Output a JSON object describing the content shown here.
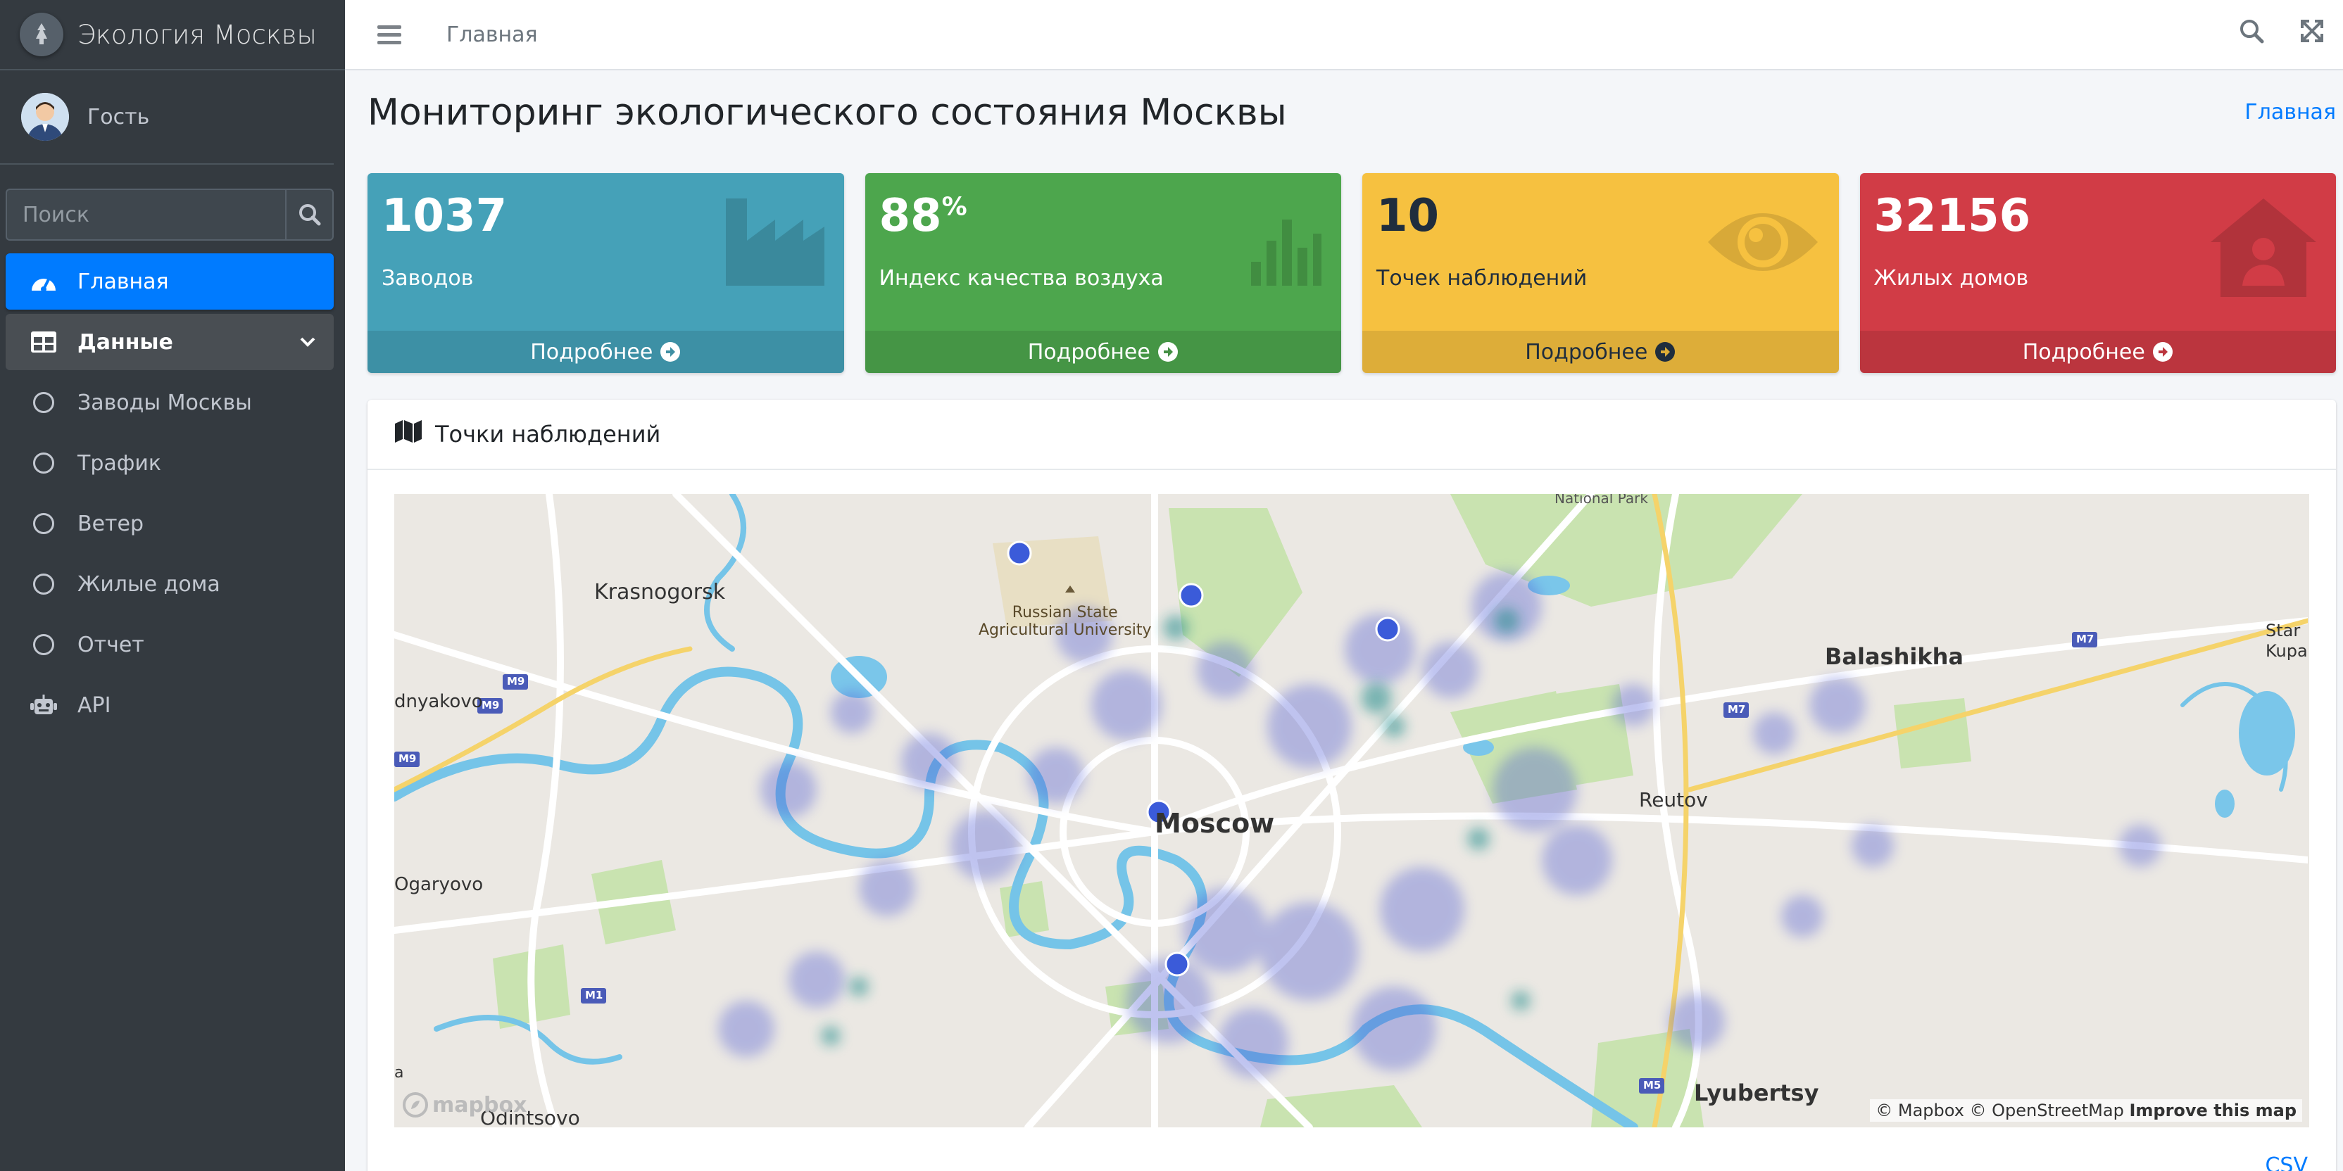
{
  "brand": {
    "title": "Экология Москвы"
  },
  "user": {
    "name": "Гость"
  },
  "search": {
    "placeholder": "Поиск"
  },
  "nav": {
    "items": [
      {
        "label": "Главная",
        "icon": "tachometer-icon"
      },
      {
        "label": "Данные",
        "icon": "table-icon"
      },
      {
        "label": "Заводы Москвы",
        "icon": "circle-icon"
      },
      {
        "label": "Трафик",
        "icon": "circle-icon"
      },
      {
        "label": "Ветер",
        "icon": "circle-icon"
      },
      {
        "label": "Жилые дома",
        "icon": "circle-icon"
      },
      {
        "label": "Отчет",
        "icon": "circle-icon"
      },
      {
        "label": "API",
        "icon": "robot-icon"
      }
    ]
  },
  "topbar": {
    "link": "Главная"
  },
  "page": {
    "title": "Мониторинг экологического состояния Москвы",
    "breadcrumb": "Главная"
  },
  "stats": [
    {
      "value": "1037",
      "suffix": "",
      "label": "Заводов",
      "more": "Подробнее",
      "icon": "industry-icon",
      "color": "#45a1b8"
    },
    {
      "value": "88",
      "suffix": "%",
      "label": "Индекс качества воздуха",
      "more": "Подробнее",
      "icon": "bar-chart-icon",
      "color": "#4da64d"
    },
    {
      "value": "10",
      "suffix": "",
      "label": "Точек наблюдений",
      "more": "Подробнее",
      "icon": "eye-icon",
      "color": "#f6c140"
    },
    {
      "value": "32156",
      "suffix": "",
      "label": "Жилых домов",
      "more": "Подробнее",
      "icon": "house-user-icon",
      "color": "#d13c46"
    }
  ],
  "map_card": {
    "title": "Точки наблюдений",
    "csv": "CSV",
    "attribution": "© Mapbox © OpenStreetMap",
    "improve": "Improve this map",
    "logo": "mapbox",
    "labels": {
      "moscow": "Moscow",
      "krasnogorsk": "Krasnogorsk",
      "balashikha": "Balashikha",
      "reutov": "Reutov",
      "lyubertsy": "Lyubertsy",
      "odintsovo": "Odintsovo",
      "ogaryovo": "Ogaryovo",
      "dnyakovo": "dnyakovo",
      "national_park": "National Park",
      "university": "Russian State\nAgricultural University",
      "star": "Star\nKupa",
      "m9a": "M9",
      "m9b": "M9",
      "m9c": "M9",
      "m7a": "M7",
      "m7b": "M7",
      "m1": "M1",
      "m5": "M5",
      "a": "a"
    }
  }
}
